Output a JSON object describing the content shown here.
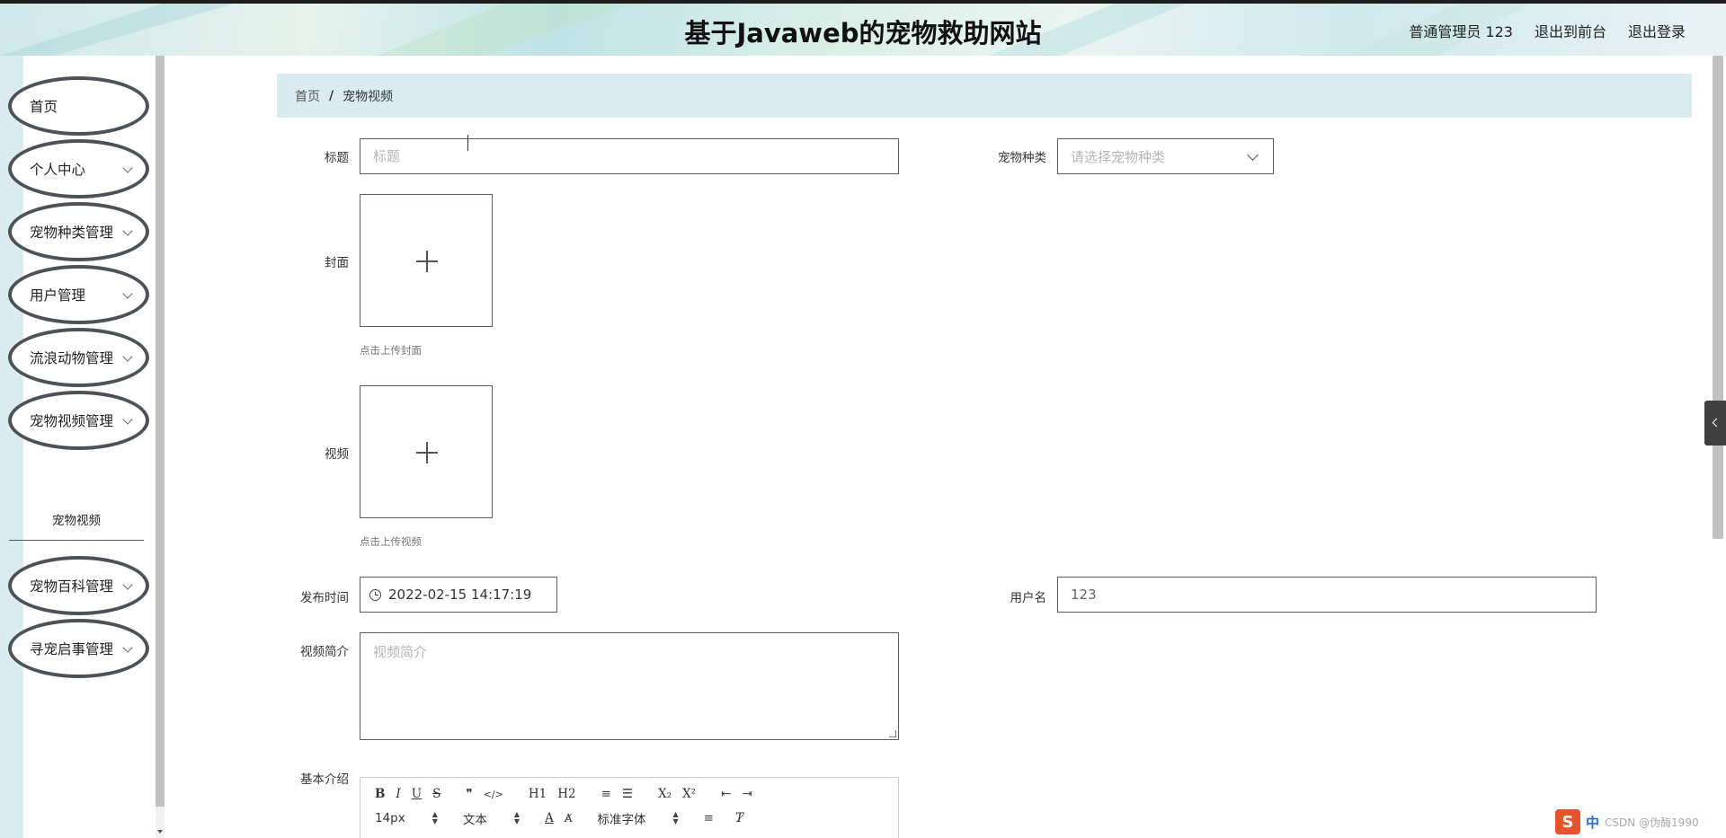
{
  "header": {
    "title": "基于Javaweb的宠物救助网站",
    "user_label": "普通管理员 123",
    "to_frontend": "退出到前台",
    "logout": "退出登录"
  },
  "sidebar": {
    "items": [
      {
        "label": "首页",
        "has_children": false
      },
      {
        "label": "个人中心",
        "has_children": true
      },
      {
        "label": "宠物种类管理",
        "has_children": true
      },
      {
        "label": "用户管理",
        "has_children": true
      },
      {
        "label": "流浪动物管理",
        "has_children": true
      },
      {
        "label": "宠物视频管理",
        "has_children": true,
        "expanded": true
      },
      {
        "label": "宠物百科管理",
        "has_children": true
      },
      {
        "label": "寻宠启事管理",
        "has_children": true
      }
    ],
    "active_sub_item": "宠物视频"
  },
  "breadcrumb": {
    "home": "首页",
    "separator": "/",
    "current": "宠物视频"
  },
  "form": {
    "title_label": "标题",
    "title_placeholder": "标题",
    "category_label": "宠物种类",
    "category_placeholder": "请选择宠物种类",
    "cover_label": "封面",
    "cover_hint": "点击上传封面",
    "video_label": "视频",
    "video_hint": "点击上传视频",
    "publish_time_label": "发布时间",
    "publish_time_value": "2022-02-15 14:17:19",
    "username_label": "用户名",
    "username_value": "123",
    "intro_label": "视频简介",
    "intro_placeholder": "视频简介",
    "detail_label": "基本介绍"
  },
  "editor": {
    "row1": [
      "B",
      "I",
      "U",
      "S",
      "❞",
      "</>",
      "H1",
      "H2",
      "≡",
      "☰",
      "X₂",
      "X²",
      "⇤",
      "⇥"
    ],
    "font_size": "14px",
    "text_type": "文本",
    "font_family": "标准字体"
  },
  "ime": {
    "logo": "S",
    "lang": "中",
    "watermark": "CSDN @伪酶1990"
  },
  "colors": {
    "breadcrumb_bg": "#daecef",
    "nav_border": "#4c5257"
  }
}
